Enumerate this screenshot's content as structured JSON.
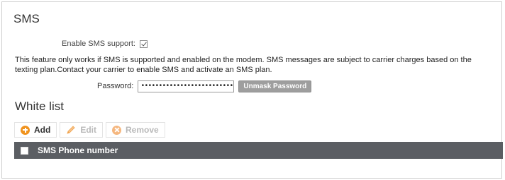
{
  "sms": {
    "title": "SMS",
    "enable_label": "Enable SMS support:",
    "enable_checked": true,
    "info_text": "This feature only works if SMS is supported and enabled on the modem. SMS messages are subject to carrier charges based on the texting plan.Contact your carrier to enable SMS and activate an SMS plan.",
    "password_label": "Password:",
    "password_value": "••••••••••••••••••••••••••••••••••",
    "unmask_label": "Unmask Password"
  },
  "white_list": {
    "title": "White list",
    "toolbar": {
      "add_label": "Add",
      "edit_label": "Edit",
      "remove_label": "Remove"
    },
    "columns": [
      "SMS Phone number"
    ]
  },
  "colors": {
    "accent_orange": "#f0931e",
    "header_bg": "#5b5e63",
    "unmask_bg": "#9e9e9e"
  }
}
